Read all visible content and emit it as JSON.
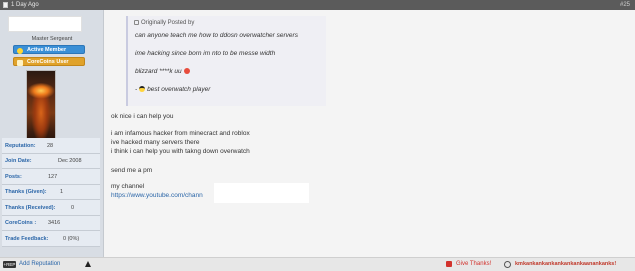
{
  "header": {
    "time": "1 Day Ago",
    "post_number": "#25"
  },
  "user": {
    "title": "Master Sergeant",
    "badges": [
      "Active Member",
      "CoreCoins User"
    ],
    "stats": [
      {
        "label": "Reputation:",
        "value": "28"
      },
      {
        "label": "Join Date:",
        "value": "Dec 2008"
      },
      {
        "label": "Posts:",
        "value": "127"
      },
      {
        "label": "Thanks (Given):",
        "value": "1"
      },
      {
        "label": "Thanks (Received):",
        "value": "0"
      },
      {
        "label": "CoreCoins :",
        "value": "3416"
      },
      {
        "label": "Trade Feedback:",
        "value": "0 (0%)"
      }
    ]
  },
  "quote": {
    "header": "Originally Posted by",
    "lines": [
      "can anyone teach me how to ddosn overwatcher servers",
      "ime hacking since born im nto to be messe width",
      "blizzard ****k uu",
      "best overwatch player"
    ],
    "cool_prefix": "-"
  },
  "message": {
    "lines": [
      "ok nice i can help you",
      "i am infamous hacker from minecract and roblox",
      "ive hacked many servers there",
      "i think i can help you with takng down overwatch",
      "send me a pm",
      "my channel",
      "https://www.youtube.com/chann"
    ]
  },
  "footer": {
    "rep_icon": "+REP",
    "add_reputation": "Add Reputation",
    "give_thanks": "Give Thanks!",
    "thanked_by": "kmkankankankankankankaanankanks!"
  },
  "colors": {
    "header_bg": "#5b5b5b",
    "link": "#2b66a8",
    "thanks": "#d2322d"
  }
}
